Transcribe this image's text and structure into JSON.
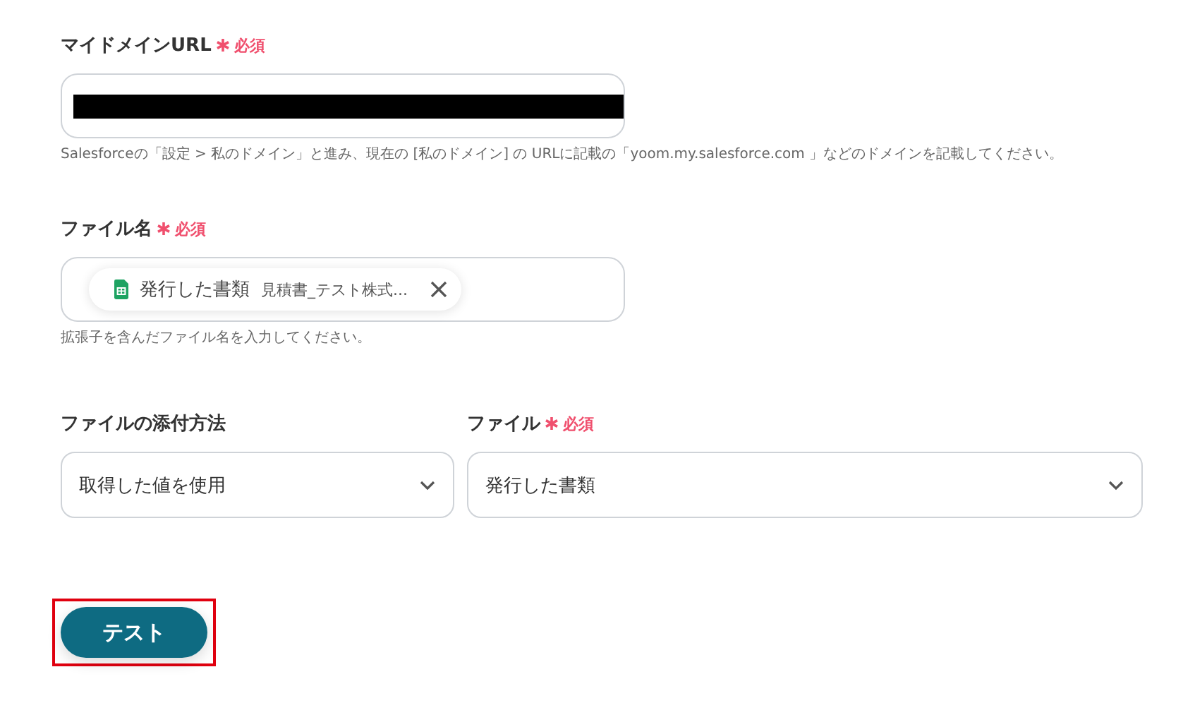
{
  "fields": [
    {
      "kind": "text",
      "label": "マイドメインURL",
      "required": true,
      "required_text": "必須",
      "value_redacted": true,
      "hint": "Salesforceの「設定 > 私のドメイン」と進み、現在の [私のドメイン] の URLに記載の「yoom.my.salesforce.com 」などのドメインを記載してください。"
    },
    {
      "kind": "chip",
      "label": "ファイル名",
      "required": true,
      "required_text": "必須",
      "chip": {
        "name": "発行した書類",
        "detail": "見積書_テスト株式..."
      },
      "hint": "拡張子を含んだファイル名を入力してください。"
    }
  ],
  "selects": [
    {
      "label": "ファイルの添付方法",
      "required": false,
      "value": "取得した値を使用"
    },
    {
      "label": "ファイル",
      "required": true,
      "required_text": "必須",
      "value": "発行した書類"
    }
  ],
  "test_button": {
    "label": "テスト",
    "highlighted": true
  }
}
